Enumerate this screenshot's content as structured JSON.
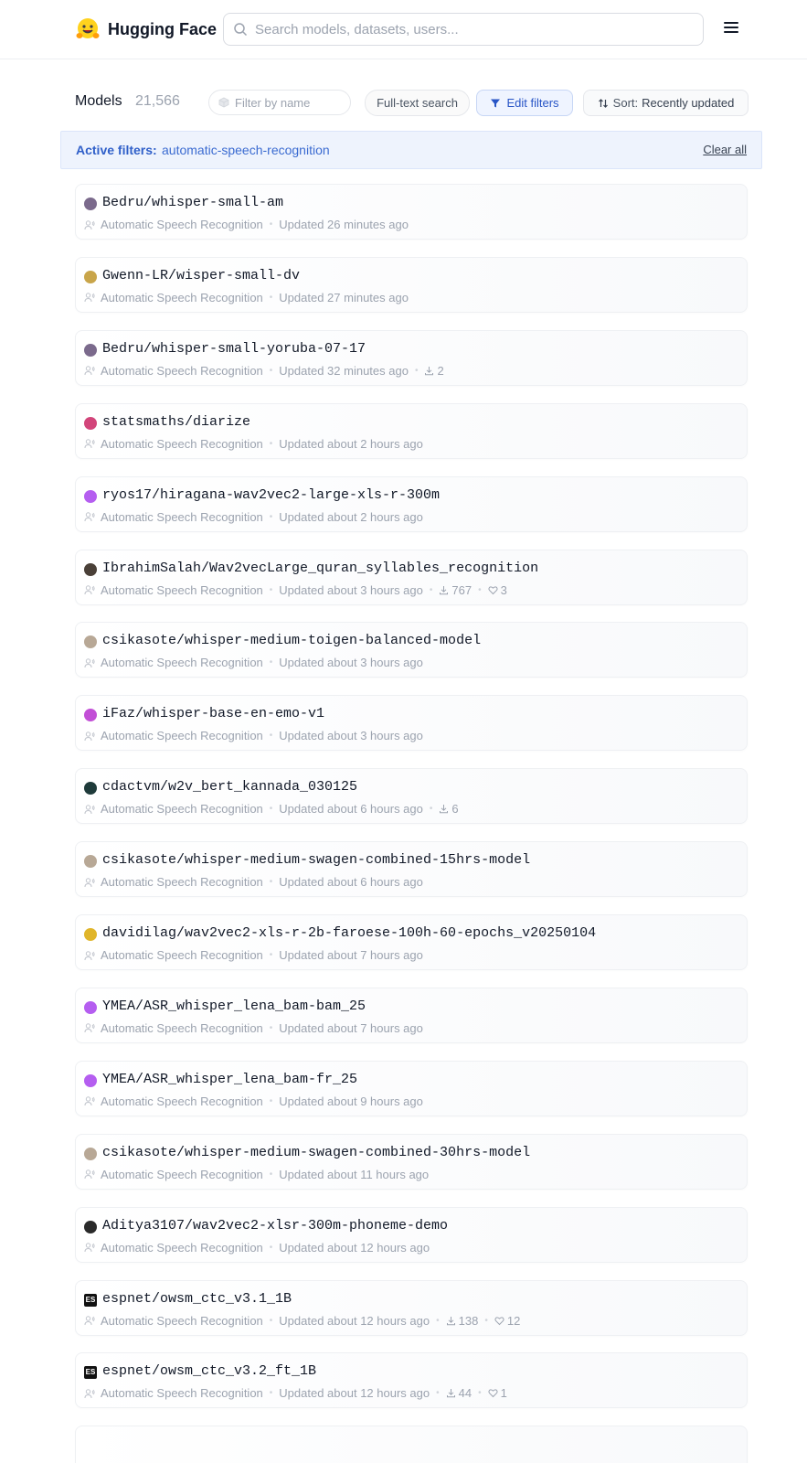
{
  "header": {
    "brand": "Hugging Face",
    "search_placeholder": "Search models, datasets, users..."
  },
  "toolbar": {
    "title": "Models",
    "count": "21,566",
    "filter_placeholder": "Filter by name",
    "fulltext_label": "Full-text search",
    "edit_filters_label": "Edit filters",
    "sort_prefix": "Sort:",
    "sort_value": "Recently updated"
  },
  "active_filters": {
    "label": "Active filters:",
    "value": "automatic-speech-recognition",
    "clear_label": "Clear all"
  },
  "models": [
    {
      "name": "Bedru/whisper-small-am",
      "task": "Automatic Speech Recognition",
      "updated": "Updated 26 minutes ago",
      "avatar": "#7b6a8c"
    },
    {
      "name": "Gwenn-LR/wisper-small-dv",
      "task": "Automatic Speech Recognition",
      "updated": "Updated 27 minutes ago",
      "avatar": "#c9a54a"
    },
    {
      "name": "Bedru/whisper-small-yoruba-07-17",
      "task": "Automatic Speech Recognition",
      "updated": "Updated 32 minutes ago",
      "downloads": "2",
      "avatar": "#7b6a8c"
    },
    {
      "name": "statsmaths/diarize",
      "task": "Automatic Speech Recognition",
      "updated": "Updated about 2 hours ago",
      "avatar": "#d2457a"
    },
    {
      "name": "ryos17/hiragana-wav2vec2-large-xls-r-300m",
      "task": "Automatic Speech Recognition",
      "updated": "Updated about 2 hours ago",
      "avatar": "#b55ef0"
    },
    {
      "name": "IbrahimSalah/Wav2vecLarge_quran_syllables_recognition",
      "task": "Automatic Speech Recognition",
      "updated": "Updated about 3 hours ago",
      "downloads": "767",
      "likes": "3",
      "avatar": "#4a4038"
    },
    {
      "name": "csikasote/whisper-medium-toigen-balanced-model",
      "task": "Automatic Speech Recognition",
      "updated": "Updated about 3 hours ago",
      "avatar": "#b8a896"
    },
    {
      "name": "iFaz/whisper-base-en-emo-v1",
      "task": "Automatic Speech Recognition",
      "updated": "Updated about 3 hours ago",
      "avatar": "#c24fd6"
    },
    {
      "name": "cdactvm/w2v_bert_kannada_030125",
      "task": "Automatic Speech Recognition",
      "updated": "Updated about 6 hours ago",
      "downloads": "6",
      "avatar": "#1f3b3a"
    },
    {
      "name": "csikasote/whisper-medium-swagen-combined-15hrs-model",
      "task": "Automatic Speech Recognition",
      "updated": "Updated about 6 hours ago",
      "avatar": "#b8a896"
    },
    {
      "name": "davidilag/wav2vec2-xls-r-2b-faroese-100h-60-epochs_v20250104",
      "task": "Automatic Speech Recognition",
      "updated": "Updated about 7 hours ago",
      "avatar": "#e0b52a"
    },
    {
      "name": "YMEA/ASR_whisper_lena_bam-bam_25",
      "task": "Automatic Speech Recognition",
      "updated": "Updated about 7 hours ago",
      "avatar": "#b55ef0"
    },
    {
      "name": "YMEA/ASR_whisper_lena_bam-fr_25",
      "task": "Automatic Speech Recognition",
      "updated": "Updated about 9 hours ago",
      "avatar": "#b55ef0"
    },
    {
      "name": "csikasote/whisper-medium-swagen-combined-30hrs-model",
      "task": "Automatic Speech Recognition",
      "updated": "Updated about 11 hours ago",
      "avatar": "#b8a896"
    },
    {
      "name": "Aditya3107/wav2vec2-xlsr-300m-phoneme-demo",
      "task": "Automatic Speech Recognition",
      "updated": "Updated about 12 hours ago",
      "avatar": "#2a2a2a"
    },
    {
      "name": "espnet/owsm_ctc_v3.1_1B",
      "task": "Automatic Speech Recognition",
      "updated": "Updated about 12 hours ago",
      "downloads": "138",
      "likes": "12",
      "avatar": "#111111",
      "avatar_text": "ES"
    },
    {
      "name": "espnet/owsm_ctc_v3.2_ft_1B",
      "task": "Automatic Speech Recognition",
      "updated": "Updated about 12 hours ago",
      "downloads": "44",
      "likes": "1",
      "avatar": "#111111",
      "avatar_text": "ES"
    }
  ]
}
